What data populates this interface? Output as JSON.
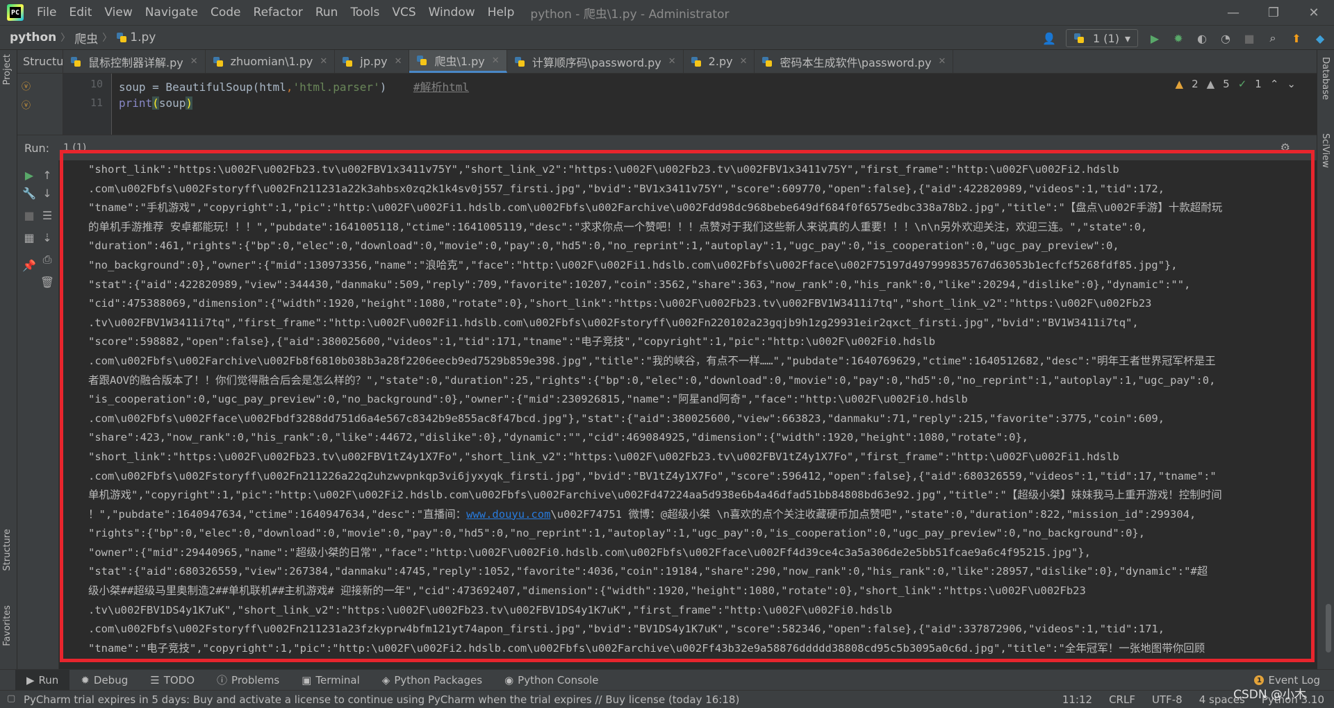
{
  "menu": {
    "items": [
      "File",
      "Edit",
      "View",
      "Navigate",
      "Code",
      "Refactor",
      "Run",
      "Tools",
      "VCS",
      "Window",
      "Help"
    ],
    "window_title": "python - 爬虫\\1.py - Administrator"
  },
  "window_controls": {
    "minimize": "—",
    "restore": "❐",
    "close": "✕"
  },
  "breadcrumb": {
    "project": "python",
    "folder": "爬虫",
    "file": "1.py"
  },
  "toolbar": {
    "run_config": "1 (1)"
  },
  "structure_panel": {
    "title": "Structur"
  },
  "tabs": [
    {
      "label": "鼠标控制器详解.py"
    },
    {
      "label": "zhuomian\\1.py"
    },
    {
      "label": "jp.py"
    },
    {
      "label": "爬虫\\1.py",
      "active": true
    },
    {
      "label": "计算顺序码\\password.py"
    },
    {
      "label": "2.py"
    },
    {
      "label": "密码本生成软件\\password.py"
    }
  ],
  "editor": {
    "lines": [
      {
        "no": "10",
        "pre": "soup = BeautifulSoup(html",
        "sep": ",",
        "str": "'html.parser'",
        "post": ")    ",
        "comment": "#解析html"
      },
      {
        "no": "11",
        "fn": "print",
        "open": "(",
        "arg": "soup",
        "close": ")"
      }
    ],
    "inspections": {
      "warnings_a": "2",
      "warnings_b": "5",
      "ok": "1"
    }
  },
  "run": {
    "label": "Run:",
    "tab_label": "1 (1)",
    "console_lines": [
      "\"short_link\":\"https:\\u002F\\u002Fb23.tv\\u002FBV1x3411v75Y\",\"short_link_v2\":\"https:\\u002F\\u002Fb23.tv\\u002FBV1x3411v75Y\",\"first_frame\":\"http:\\u002F\\u002Fi2.hdslb",
      ".com\\u002Fbfs\\u002Fstoryff\\u002Fn211231a22k3ahbsx0zq2k1k4sv0j557_firsti.jpg\",\"bvid\":\"BV1x3411v75Y\",\"score\":609770,\"open\":false},{\"aid\":422820989,\"videos\":1,\"tid\":172,",
      "\"tname\":\"手机游戏\",\"copyright\":1,\"pic\":\"http:\\u002F\\u002Fi1.hdslb.com\\u002Fbfs\\u002Farchive\\u002Fdd98dc968bebe649df684f0f6575edbc338a78b2.jpg\",\"title\":\"【盘点\\u002F手游】十款超耐玩",
      "的单机手游推荐 安卓都能玩！！！\",\"pubdate\":1641005118,\"ctime\":1641005119,\"desc\":\"求求你点一个赞吧！！！点赞对于我们这些新人来说真的人重要！！！\\n\\n另外欢迎关注，欢迎三连。\",\"state\":0,",
      "\"duration\":461,\"rights\":{\"bp\":0,\"elec\":0,\"download\":0,\"movie\":0,\"pay\":0,\"hd5\":0,\"no_reprint\":1,\"autoplay\":1,\"ugc_pay\":0,\"is_cooperation\":0,\"ugc_pay_preview\":0,",
      "\"no_background\":0},\"owner\":{\"mid\":130973356,\"name\":\"浪哈克\",\"face\":\"http:\\u002F\\u002Fi1.hdslb.com\\u002Fbfs\\u002Fface\\u002F75197d497999835767d63053b1ecfcf5268fdf85.jpg\"},",
      "\"stat\":{\"aid\":422820989,\"view\":344430,\"danmaku\":509,\"reply\":709,\"favorite\":10207,\"coin\":3562,\"share\":363,\"now_rank\":0,\"his_rank\":0,\"like\":20294,\"dislike\":0},\"dynamic\":\"\",",
      "\"cid\":475388069,\"dimension\":{\"width\":1920,\"height\":1080,\"rotate\":0},\"short_link\":\"https:\\u002F\\u002Fb23.tv\\u002FBV1W3411i7tq\",\"short_link_v2\":\"https:\\u002F\\u002Fb23",
      ".tv\\u002FBV1W3411i7tq\",\"first_frame\":\"http:\\u002F\\u002Fi1.hdslb.com\\u002Fbfs\\u002Fstoryff\\u002Fn220102a23gqjb9h1zg29931eir2qxct_firsti.jpg\",\"bvid\":\"BV1W3411i7tq\",",
      "\"score\":598882,\"open\":false},{\"aid\":380025600,\"videos\":1,\"tid\":171,\"tname\":\"电子竞技\",\"copyright\":1,\"pic\":\"http:\\u002F\\u002Fi0.hdslb",
      ".com\\u002Fbfs\\u002Farchive\\u002Fb8f6810b038b3a28f2206eecb9ed7529b859e398.jpg\",\"title\":\"我的峡谷，有点不一样……\",\"pubdate\":1640769629,\"ctime\":1640512682,\"desc\":\"明年王者世界冠军杯是王",
      "者跟AOV的融合版本了！！你们觉得融合后会是怎么样的？\",\"state\":0,\"duration\":25,\"rights\":{\"bp\":0,\"elec\":0,\"download\":0,\"movie\":0,\"pay\":0,\"hd5\":0,\"no_reprint\":1,\"autoplay\":1,\"ugc_pay\":0,",
      "\"is_cooperation\":0,\"ugc_pay_preview\":0,\"no_background\":0},\"owner\":{\"mid\":230926815,\"name\":\"阿星and阿奇\",\"face\":\"http:\\u002F\\u002Fi0.hdslb",
      ".com\\u002Fbfs\\u002Fface\\u002Fbdf3288dd751d6a4e567c8342b9e855ac8f47bcd.jpg\"},\"stat\":{\"aid\":380025600,\"view\":663823,\"danmaku\":71,\"reply\":215,\"favorite\":3775,\"coin\":609,",
      "\"share\":423,\"now_rank\":0,\"his_rank\":0,\"like\":44672,\"dislike\":0},\"dynamic\":\"\",\"cid\":469084925,\"dimension\":{\"width\":1920,\"height\":1080,\"rotate\":0},",
      "\"short_link\":\"https:\\u002F\\u002Fb23.tv\\u002FBV1tZ4y1X7Fo\",\"short_link_v2\":\"https:\\u002F\\u002Fb23.tv\\u002FBV1tZ4y1X7Fo\",\"first_frame\":\"http:\\u002F\\u002Fi1.hdslb",
      ".com\\u002Fbfs\\u002Fstoryff\\u002Fn211226a22q2uhzwvpnkqp3vi6jyxyqk_firsti.jpg\",\"bvid\":\"BV1tZ4y1X7Fo\",\"score\":596412,\"open\":false},{\"aid\":680326559,\"videos\":1,\"tid\":17,\"tname\":\"",
      "单机游戏\",\"copyright\":1,\"pic\":\"http:\\u002F\\u002Fi2.hdslb.com\\u002Fbfs\\u002Farchive\\u002Fd47224aa5d938e6b4a46dfad51bb84808bd63e92.jpg\",\"title\":\"【超级小桀】妹妹我马上重开游戏！控制时间",
      "！\",\"pubdate\":1640947634,\"ctime\":1640947634,\"desc\":\"直播间：",
      "\"rights\":{\"bp\":0,\"elec\":0,\"download\":0,\"movie\":0,\"pay\":0,\"hd5\":0,\"no_reprint\":1,\"autoplay\":1,\"ugc_pay\":0,\"is_cooperation\":0,\"ugc_pay_preview\":0,\"no_background\":0},",
      "\"owner\":{\"mid\":29440965,\"name\":\"超级小桀的日常\",\"face\":\"http:\\u002F\\u002Fi0.hdslb.com\\u002Fbfs\\u002Fface\\u002Ff4d39ce4c3a5a306de2e5bb51fcae9a6c4f95215.jpg\"},",
      "\"stat\":{\"aid\":680326559,\"view\":267384,\"danmaku\":4745,\"reply\":1052,\"favorite\":4036,\"coin\":19184,\"share\":290,\"now_rank\":0,\"his_rank\":0,\"like\":28957,\"dislike\":0},\"dynamic\":\"#超",
      "级小桀##超级马里奥制造2##单机联机##主机游戏# 迎接新的一年\",\"cid\":473692407,\"dimension\":{\"width\":1920,\"height\":1080,\"rotate\":0},\"short_link\":\"https:\\u002F\\u002Fb23",
      ".tv\\u002FBV1DS4y1K7uK\",\"short_link_v2\":\"https:\\u002F\\u002Fb23.tv\\u002FBV1DS4y1K7uK\",\"first_frame\":\"http:\\u002F\\u002Fi0.hdslb",
      ".com\\u002Fbfs\\u002Fstoryff\\u002Fn211231a23fzkyprw4bfm121yt74apon_firsti.jpg\",\"bvid\":\"BV1DS4y1K7uK\",\"score\":582346,\"open\":false},{\"aid\":337872906,\"videos\":1,\"tid\":171,",
      "\"tname\":\"电子竞技\",\"copyright\":1,\"pic\":\"http:\\u002F\\u002Fi2.hdslb.com\\u002Fbfs\\u002Farchive\\u002Ff43b32e9a58876ddddd38808cd95c5b3095a0c6d.jpg\",\"title\":\"全年冠军！一张地图带你回顾"
    ],
    "link_text": "www.douyu.com",
    "link_line_tail": "\\u002F74751 微博：@超级小桀 \\n喜欢的点个关注收藏硬币加点赞吧\",\"state\":0,\"duration\":822,\"mission_id\":299304,"
  },
  "bottom_tools": [
    "Run",
    "Debug",
    "TODO",
    "Problems",
    "Terminal",
    "Python Packages",
    "Python Console"
  ],
  "event_log": {
    "label": "Event Log",
    "count": "1"
  },
  "side_labels": {
    "project": "Project",
    "structure": "Structure",
    "favorites": "Favorites",
    "database": "Database",
    "sciview": "SciView"
  },
  "status": {
    "message": "PyCharm trial expires in 5 days: Buy and activate a license to continue using PyCharm when the trial expires // Buy license (today 16:18)",
    "position": "11:12",
    "line_sep": "CRLF",
    "encoding": "UTF-8",
    "indent": "4 spaces",
    "interpreter": "Python 3.10"
  },
  "watermark": "CSDN @小木",
  "colors": {
    "highlight_box": "#e8252d",
    "accent": "#4a88c7",
    "run_green": "#59a869"
  }
}
